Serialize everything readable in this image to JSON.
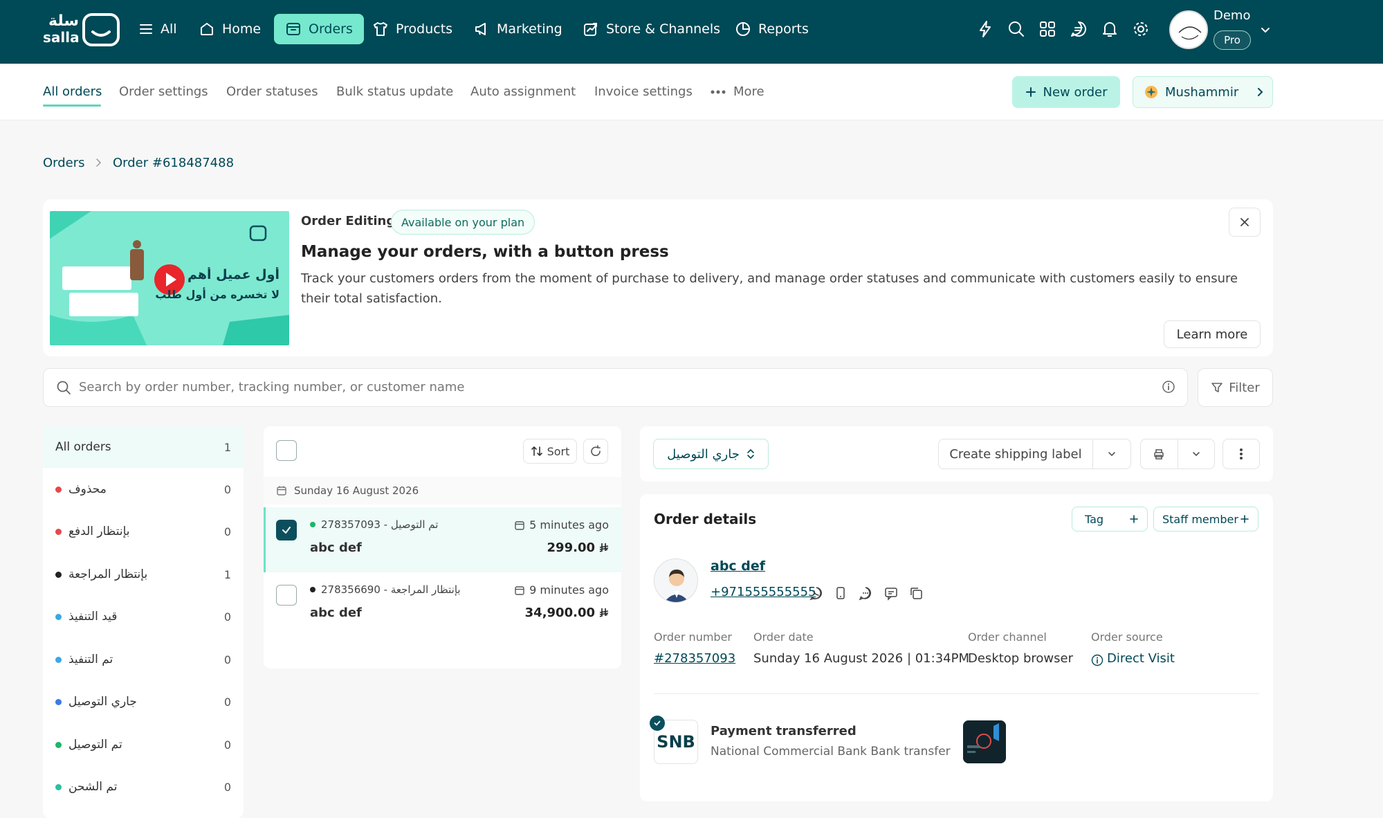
{
  "brand": {
    "arabic": "سلة",
    "latin": "salla"
  },
  "topnav": [
    {
      "label": "All",
      "icon": "menu-icon"
    },
    {
      "label": "Home",
      "icon": "home-icon"
    },
    {
      "label": "Orders",
      "icon": "orders-box-icon",
      "active": true
    },
    {
      "label": "Products",
      "icon": "shirt-icon"
    },
    {
      "label": "Marketing",
      "icon": "megaphone-icon"
    },
    {
      "label": "Store & Channels",
      "icon": "store-icon"
    },
    {
      "label": "Reports",
      "icon": "pie-chart-icon"
    }
  ],
  "top_icons": [
    "lightning-icon",
    "search-icon",
    "apps-grid-icon",
    "chat-icon",
    "bell-icon",
    "gear-icon"
  ],
  "user": {
    "name": "Demo",
    "plan": "Pro"
  },
  "subnav": {
    "tabs": [
      "All orders",
      "Order settings",
      "Order statuses",
      "Bulk status update",
      "Auto assignment",
      "Invoice settings"
    ],
    "more": "More",
    "new_order": "New order",
    "assistant": "Mushammir"
  },
  "breadcrumb": {
    "root": "Orders",
    "current": "Order #618487488"
  },
  "banner": {
    "label": "Order Editing",
    "badge": "Available on your plan",
    "title": "Manage your orders, with a button press",
    "description": "Track your customers orders from the moment of purchase to delivery, and manage order statuses and communicate with customers easily to ensure their total satisfaction.",
    "learn_more": "Learn more",
    "thumb_line1": "أول عميل أهم ع",
    "thumb_line2": "لا تخسره من أول طلب"
  },
  "search": {
    "placeholder": "Search by order number, tracking number, or customer name",
    "filter": "Filter"
  },
  "statuses": [
    {
      "label": "All orders",
      "count": "1",
      "color": "",
      "active": true
    },
    {
      "label": "محذوف",
      "count": "0",
      "color": "#e5484d"
    },
    {
      "label": "بإنتظار الدفع",
      "count": "0",
      "color": "#e5484d"
    },
    {
      "label": "بإنتظار المراجعة",
      "count": "1",
      "color": "#222222"
    },
    {
      "label": "قيد التنفيذ",
      "count": "0",
      "color": "#3ba7e6"
    },
    {
      "label": "تم التنفيذ",
      "count": "0",
      "color": "#3ba7e6"
    },
    {
      "label": "جاري التوصيل",
      "count": "0",
      "color": "#3b7be6"
    },
    {
      "label": "تم التوصيل",
      "count": "0",
      "color": "#1fb56b"
    },
    {
      "label": "تم الشحن",
      "count": "0",
      "color": "#2dbf9e"
    }
  ],
  "orders_list": {
    "sort": "Sort",
    "date": "Sunday 16 August 2026",
    "orders": [
      {
        "meta": "278357093 - تم التوصيل",
        "dot": "#1fb56b",
        "name": "abc def",
        "time": "5 minutes ago",
        "amount": "299.00",
        "selected": true
      },
      {
        "meta": "278356690 - بإنتظار المراجعة",
        "dot": "#222222",
        "name": "abc def",
        "time": "9 minutes ago",
        "amount": "34,900.00",
        "selected": false
      }
    ]
  },
  "detail": {
    "status": "جاري التوصيل",
    "create_label": "Create shipping label",
    "title": "Order details",
    "tag": "Tag",
    "staff": "Staff member",
    "customer": {
      "name": "abc def",
      "phone": "+971555555555"
    },
    "fields": [
      {
        "label": "Order number",
        "value": "#278357093"
      },
      {
        "label": "Order date",
        "value": "Sunday 16 August 2026 | 01:34PM"
      },
      {
        "label": "Order channel",
        "value": "Desktop browser"
      },
      {
        "label": "Order source",
        "value": "Direct Visit"
      }
    ],
    "payment": {
      "bank_logo": "SNB",
      "title": "Payment transferred",
      "subtitle": "National Commercial Bank Bank transfer"
    }
  },
  "colors": {
    "topbar": "#004956",
    "accent": "#76e8cd",
    "currency": "riyal-symbol-icon"
  }
}
